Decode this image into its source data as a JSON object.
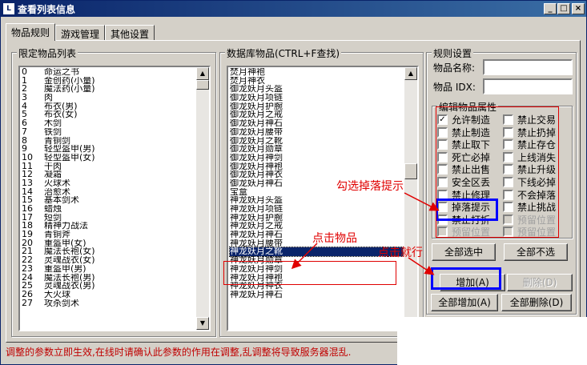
{
  "window": {
    "title": "查看列表信息",
    "app_icon": "app-logo-icon"
  },
  "tabs": [
    {
      "label": "物品规则",
      "active": true
    },
    {
      "label": "游戏管理",
      "active": false
    },
    {
      "label": "其他设置",
      "active": false
    }
  ],
  "restricted_list": {
    "title": "限定物品列表",
    "rows": [
      {
        "n": "0",
        "name": "命运之书"
      },
      {
        "n": "1",
        "name": "金创药(小量)"
      },
      {
        "n": "2",
        "name": "魔法药(小量)"
      },
      {
        "n": "3",
        "name": "肉"
      },
      {
        "n": "4",
        "name": "布衣(男)"
      },
      {
        "n": "5",
        "name": "布衣(女)"
      },
      {
        "n": "6",
        "name": "木剑"
      },
      {
        "n": "7",
        "name": "铁剑"
      },
      {
        "n": "8",
        "name": "青铜剑"
      },
      {
        "n": "9",
        "name": "轻型盔甲(男)"
      },
      {
        "n": "10",
        "name": "轻型盔甲(女)"
      },
      {
        "n": "11",
        "name": "干肉"
      },
      {
        "n": "12",
        "name": "凝霜"
      },
      {
        "n": "13",
        "name": "火球术"
      },
      {
        "n": "14",
        "name": "治愈术"
      },
      {
        "n": "15",
        "name": "基本剑术"
      },
      {
        "n": "16",
        "name": "蜡烛"
      },
      {
        "n": "17",
        "name": "短剑"
      },
      {
        "n": "18",
        "name": "精神力战法"
      },
      {
        "n": "19",
        "name": "青铜斧"
      },
      {
        "n": "20",
        "name": "重盔甲(女)"
      },
      {
        "n": "21",
        "name": "魔法长袍(女)"
      },
      {
        "n": "22",
        "name": "灵魂战衣(女)"
      },
      {
        "n": "23",
        "name": "重盔甲(男)"
      },
      {
        "n": "24",
        "name": "魔法长袍(男)"
      },
      {
        "n": "25",
        "name": "灵魂战衣(男)"
      },
      {
        "n": "26",
        "name": "大火球"
      },
      {
        "n": "27",
        "name": "攻杀剑术"
      }
    ]
  },
  "db_items": {
    "title": "数据库物品(CTRL+F查找)",
    "rows": [
      "焚月神袍",
      "焚月神衣",
      "御龙妖月头盔",
      "御龙妖月项链",
      "御龙妖月护腕",
      "御龙妖月之戒",
      "御龙妖月神石",
      "御龙妖月腰带",
      "御龙妖月之靴",
      "御龙妖月勋章",
      "御龙妖月神剑",
      "御龙妖月神袍",
      "御龙妖月神衣",
      "御龙妖月神石",
      "宝盒",
      "神龙妖月头盔",
      "神龙妖月项链",
      "神龙妖月护腕",
      "神龙妖月之戒",
      "神龙妖月神石",
      "神龙妖月腰带",
      "神龙妖月之靴",
      "神龙妖月勋章",
      "神龙妖月神剑",
      "神龙妖月神袍",
      "神龙妖月神衣",
      "神龙妖月神石"
    ],
    "selected_index": 21
  },
  "rules": {
    "title": "规则设置",
    "item_name_label": "物品名称:",
    "item_name_value": "",
    "item_idx_label": "物品 IDX:",
    "item_idx_value": "",
    "attr_title": "编辑物品属性",
    "checkboxes": [
      {
        "label": "允许制造",
        "checked": true,
        "disabled": false
      },
      {
        "label": "禁止交易",
        "checked": false,
        "disabled": false
      },
      {
        "label": "禁止制造",
        "checked": false,
        "disabled": false
      },
      {
        "label": "禁止扔掉",
        "checked": false,
        "disabled": false
      },
      {
        "label": "禁止取下",
        "checked": false,
        "disabled": false
      },
      {
        "label": "禁止存仓",
        "checked": false,
        "disabled": false
      },
      {
        "label": "死亡必掉",
        "checked": false,
        "disabled": false
      },
      {
        "label": "上线消失",
        "checked": false,
        "disabled": false
      },
      {
        "label": "禁止出售",
        "checked": false,
        "disabled": false
      },
      {
        "label": "禁止升级",
        "checked": false,
        "disabled": false
      },
      {
        "label": "安全区丢",
        "checked": false,
        "disabled": false
      },
      {
        "label": "下线必掉",
        "checked": false,
        "disabled": false
      },
      {
        "label": "禁止修理",
        "checked": false,
        "disabled": false
      },
      {
        "label": "不会掉落",
        "checked": false,
        "disabled": false
      },
      {
        "label": "掉落提示",
        "checked": false,
        "disabled": false
      },
      {
        "label": "禁止挑战",
        "checked": false,
        "disabled": false
      },
      {
        "label": "禁止打折",
        "checked": false,
        "disabled": false
      },
      {
        "label": "预留位置",
        "checked": false,
        "disabled": true
      },
      {
        "label": "预留位置",
        "checked": false,
        "disabled": true
      },
      {
        "label": "预留位置",
        "checked": false,
        "disabled": true
      }
    ],
    "select_all": "全部选中",
    "select_none": "全部不选",
    "add": "增加(A)",
    "delete": "删除(D)",
    "add_all": "全部增加(A)",
    "delete_all": "全部删除(D)"
  },
  "status": "调整的参数立即生效,在线时请确认此参数的作用在调整,乱调整将导致服务器混乱.",
  "annotations": {
    "check_drop_hint": "勾选掉落提示",
    "click_item": "点击物品",
    "click_done": "点击就行"
  },
  "colors": {
    "accent": "#0a246a",
    "annotation": "#e00000",
    "highlight_box": "#0000ff"
  }
}
